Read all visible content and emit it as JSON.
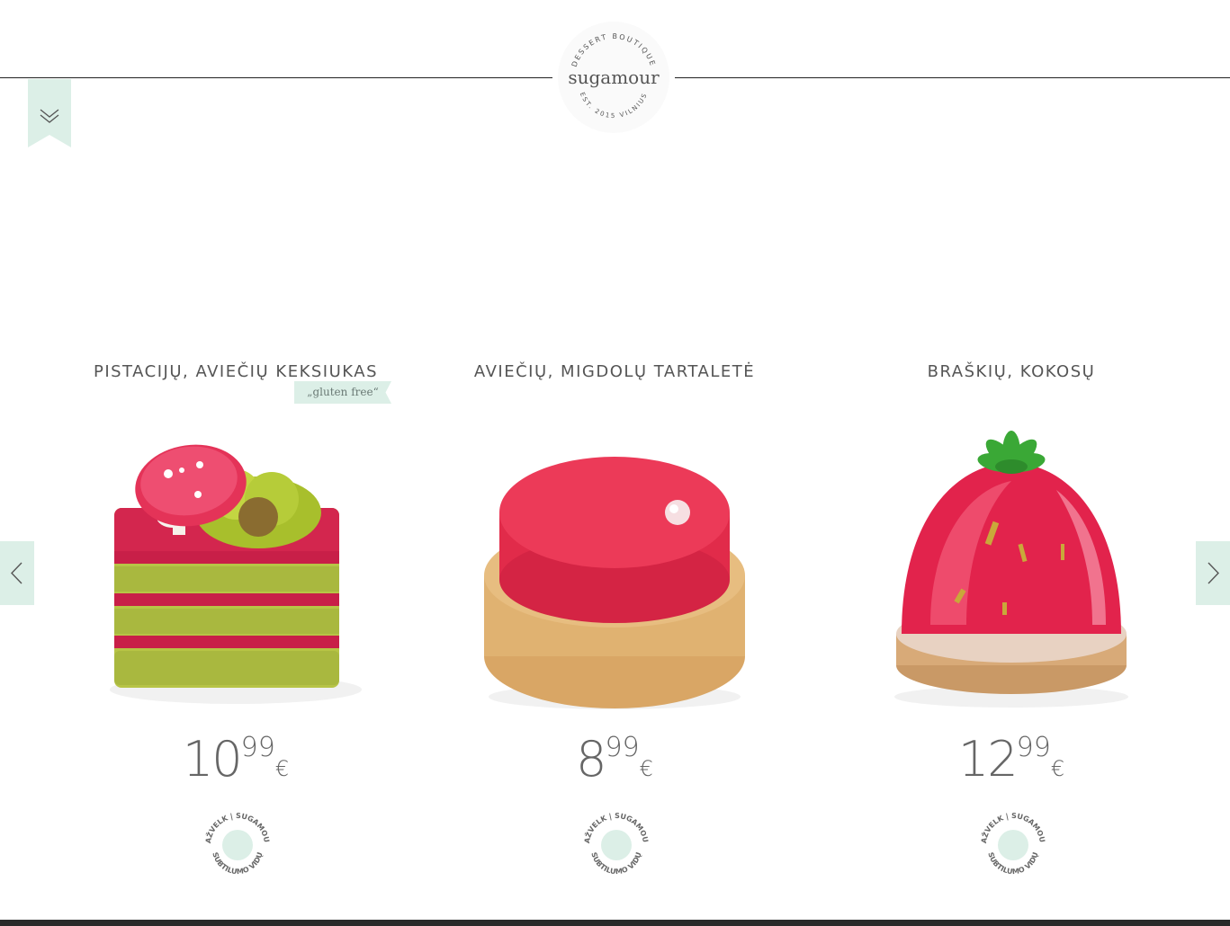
{
  "brand": {
    "name": "sugamour",
    "tagline_top": "DESSERT BOUTIQUE",
    "tagline_bottom": "EST. 2015 VILNIUS"
  },
  "badge_text": {
    "top": "PAŽVELK | SUGAMOUR",
    "bottom": "SUBTILUMO VIDŲ"
  },
  "products": [
    {
      "title": "PISTACIJŲ, AVIEČIŲ KEKSIUKAS",
      "tag": "„gluten free“",
      "price_int": "10",
      "price_dec": "99",
      "currency": "€"
    },
    {
      "title": "AVIEČIŲ, MIGDOLŲ TARTALETĖ",
      "price_int": "8",
      "price_dec": "99",
      "currency": "€"
    },
    {
      "title": "BRAŠKIŲ, KOKOSŲ",
      "price_int": "12",
      "price_dec": "99",
      "currency": "€"
    }
  ],
  "colors": {
    "accent_mint": "#dcefe7",
    "text_gray": "#555555",
    "raspberry": "#e0214b",
    "pistachio": "#b4c24a"
  },
  "icons": {
    "menu": "double-chevron-down-icon",
    "prev": "chevron-left-icon",
    "next": "chevron-right-icon"
  }
}
